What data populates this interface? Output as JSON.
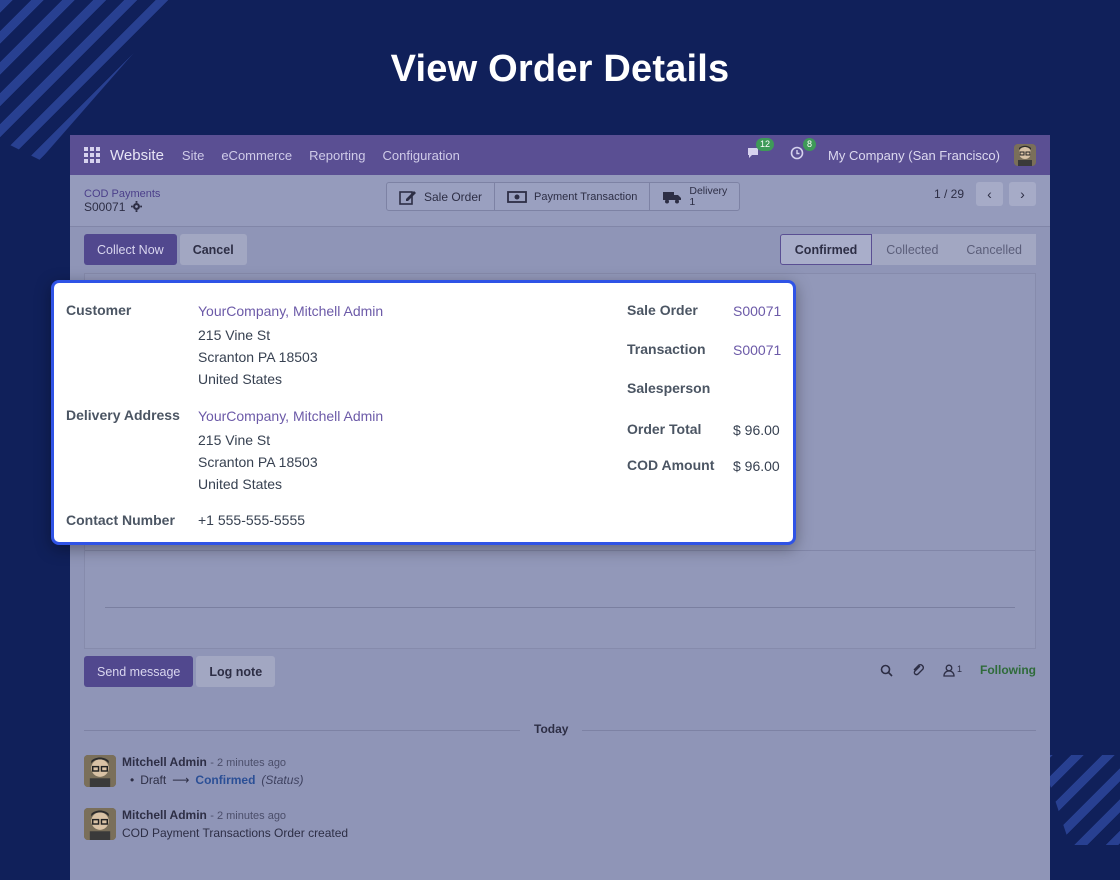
{
  "banner": {
    "title": "View Order Details"
  },
  "navbar": {
    "brand": "Website",
    "menu": [
      "Site",
      "eCommerce",
      "Reporting",
      "Configuration"
    ],
    "messages_count": "12",
    "activities_count": "8",
    "company": "My Company (San Francisco)"
  },
  "control": {
    "breadcrumb_parent": "COD Payments",
    "breadcrumb_current": "S00071",
    "smart_buttons": {
      "sale_order": "Sale Order",
      "payment_transaction": "Payment Transaction",
      "delivery_label": "Delivery",
      "delivery_count": "1"
    },
    "pager": "1 / 29"
  },
  "actions": {
    "collect_now": "Collect Now",
    "cancel": "Cancel"
  },
  "statusbar": {
    "confirmed": "Confirmed",
    "collected": "Collected",
    "cancelled": "Cancelled"
  },
  "details": {
    "customer_label": "Customer",
    "customer_name": "YourCompany, Mitchell Admin",
    "customer_street": "215 Vine St",
    "customer_city": "Scranton PA 18503",
    "customer_country": "United States",
    "delivery_label": "Delivery Address",
    "delivery_name": "YourCompany, Mitchell Admin",
    "delivery_street": "215 Vine St",
    "delivery_city": "Scranton PA 18503",
    "delivery_country": "United States",
    "contact_label": "Contact Number",
    "contact_value": "+1 555-555-5555",
    "sale_order_label": "Sale Order",
    "sale_order_value": "S00071",
    "transaction_label": "Transaction",
    "transaction_value": "S00071",
    "salesperson_label": "Salesperson",
    "order_total_label": "Order Total",
    "order_total_value": "$ 96.00",
    "cod_amount_label": "COD Amount",
    "cod_amount_value": "$ 96.00"
  },
  "chatter": {
    "send_message": "Send message",
    "log_note": "Log note",
    "followers_count": "1",
    "following": "Following",
    "today": "Today",
    "messages": [
      {
        "author": "Mitchell Admin",
        "time": "- 2 minutes ago",
        "from": "Draft",
        "to": "Confirmed",
        "field": "(Status)"
      },
      {
        "author": "Mitchell Admin",
        "time": "- 2 minutes ago",
        "body": "COD Payment Transactions Order created"
      }
    ]
  },
  "colors": {
    "background": "#10205a",
    "navbar": "#5a4f93",
    "highlight_border": "#2f53e6",
    "link": "#6c5aa8"
  }
}
